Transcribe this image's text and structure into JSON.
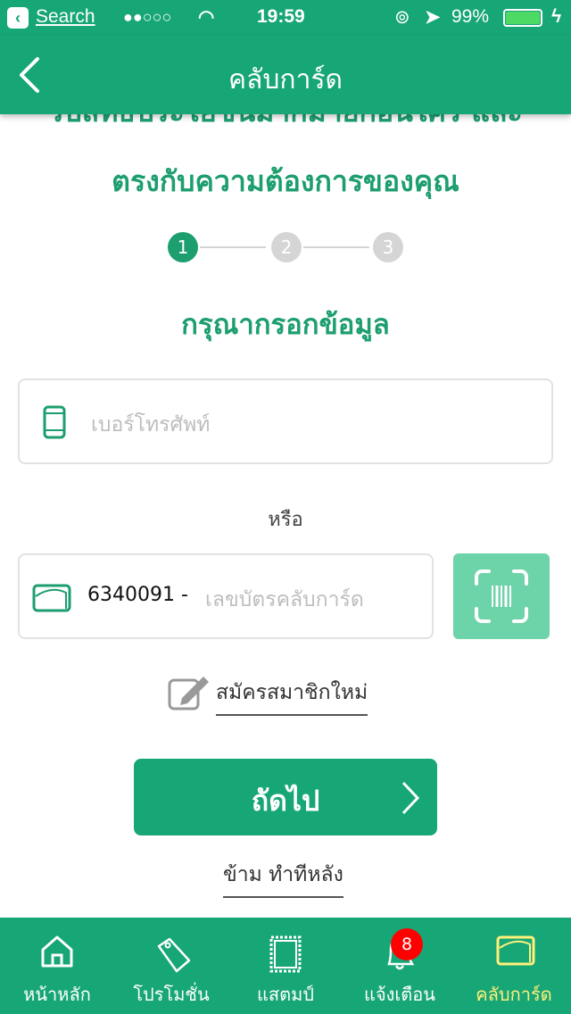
{
  "status_bar": {
    "back_app": "Search",
    "signal": "●●○○○",
    "time": "19:59",
    "battery": "99%"
  },
  "nav": {
    "title": "คลับการ์ด"
  },
  "intro": {
    "line1": "รับสิทธิประโยชน์มากมายก่อนใคร และ",
    "line2": "ตรงกับความต้องการของคุณ"
  },
  "steps": {
    "items": [
      "1",
      "2",
      "3"
    ],
    "current": 1,
    "active_color": "#1d9e6f",
    "inactive_color": "#d5d5d5"
  },
  "form": {
    "heading": "กรุณากรอกข้อมูล",
    "phone_placeholder": "เบอร์โทรศัพท์",
    "or_label": "หรือ",
    "card_prefix": "6340091 -",
    "card_placeholder": "เลขบัตรคลับการ์ด",
    "register_label": "สมัครสมาชิกใหม่",
    "next_label": "ถัดไป",
    "skip_label": "ข้าม ทำทีหลัง"
  },
  "tabbar": {
    "items": [
      {
        "label": "หน้าหลัก",
        "icon": "home-icon"
      },
      {
        "label": "โปรโมชั่น",
        "icon": "tag-icon"
      },
      {
        "label": "แสตมป์",
        "icon": "stamp-icon"
      },
      {
        "label": "แจ้งเตือน",
        "icon": "bell-icon",
        "badge": "8"
      },
      {
        "label": "คลับการ์ด",
        "icon": "card-icon",
        "active": true
      }
    ],
    "active_color": "#fff07a"
  },
  "colors": {
    "brand": "#17a676",
    "scan_button": "#6dd3a8"
  }
}
